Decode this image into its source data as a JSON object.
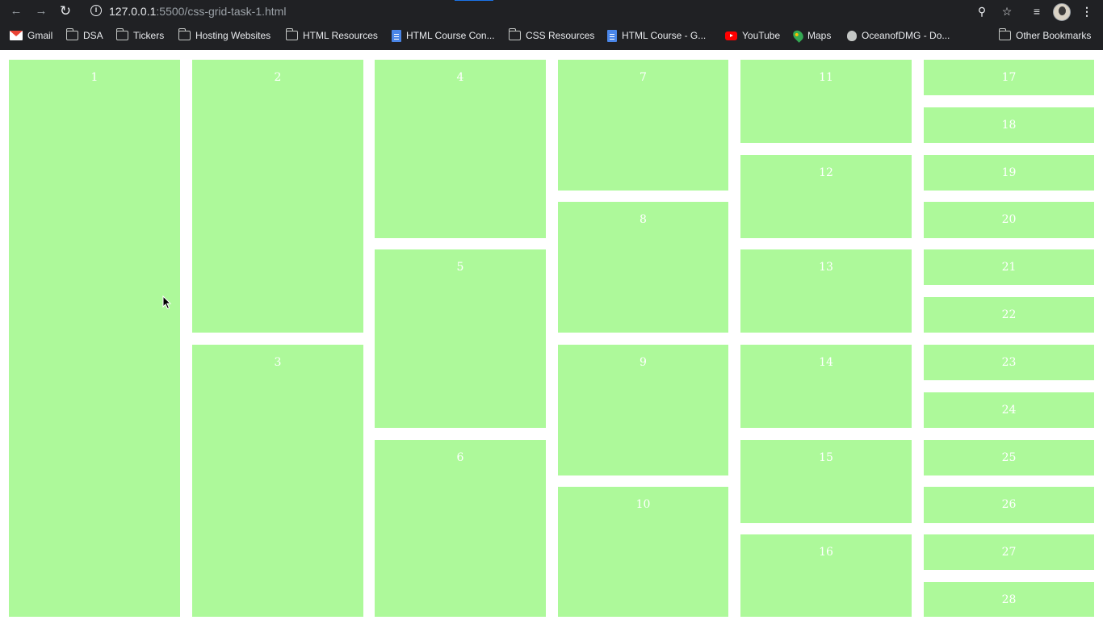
{
  "browser": {
    "url_host": "127.0.0.1",
    "url_path": ":5500/css-grid-task-1.html",
    "bookmarks": [
      {
        "label": "Gmail",
        "icon": "gmail-icon"
      },
      {
        "label": "DSA",
        "icon": "folder-icon"
      },
      {
        "label": "Tickers",
        "icon": "folder-icon"
      },
      {
        "label": "Hosting Websites",
        "icon": "folder-icon"
      },
      {
        "label": "HTML Resources",
        "icon": "folder-icon"
      },
      {
        "label": "HTML Course Con...",
        "icon": "docs-icon"
      },
      {
        "label": "CSS Resources",
        "icon": "folder-icon"
      },
      {
        "label": "HTML Course - G...",
        "icon": "docs-icon"
      },
      {
        "label": "YouTube",
        "icon": "youtube-icon"
      },
      {
        "label": "Maps",
        "icon": "maps-icon"
      },
      {
        "label": "OceanofDMG - Do...",
        "icon": "apple-icon"
      },
      {
        "label": "Other Bookmarks",
        "icon": "folder-icon"
      }
    ]
  },
  "page": {
    "cell_color": "#adf99a",
    "cells": [
      "1",
      "2",
      "3",
      "4",
      "5",
      "6",
      "7",
      "8",
      "9",
      "10",
      "11",
      "12",
      "13",
      "14",
      "15",
      "16",
      "17",
      "18",
      "19",
      "20",
      "21",
      "22",
      "23",
      "24",
      "25",
      "26",
      "27",
      "28"
    ]
  }
}
